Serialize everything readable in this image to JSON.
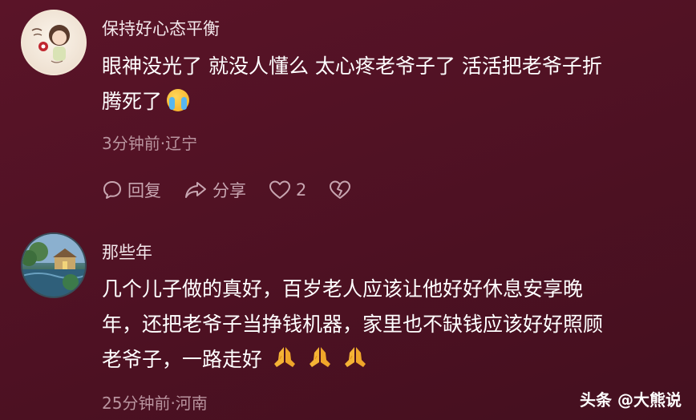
{
  "comments": [
    {
      "username": "保持好心态平衡",
      "text_line1": "眼神没光了 就没人懂么 太心疼老爷子了 活活把老爷子折",
      "text_line2": "腾死了",
      "emoji": "loudly-crying-face-icon",
      "meta": "3分钟前·辽宁",
      "actions": {
        "reply_label": "回复",
        "share_label": "分享",
        "like_count": "2"
      }
    },
    {
      "username": "那些年",
      "text_line1": "几个儿子做的真好，百岁老人应该让他好好休息安享晚",
      "text_line2": "年，还把老爷子当挣钱机器，家里也不缺钱应该好好照顾",
      "text_line3": "老爷子，一路走好",
      "emoji": "folded-hands-icon",
      "meta": "25分钟前·河南"
    }
  ],
  "watermark": "头条 @大熊说",
  "colors": {
    "background": "#4e1123",
    "meta_text": "#b9949f",
    "action_icon": "#c7a5b0"
  }
}
